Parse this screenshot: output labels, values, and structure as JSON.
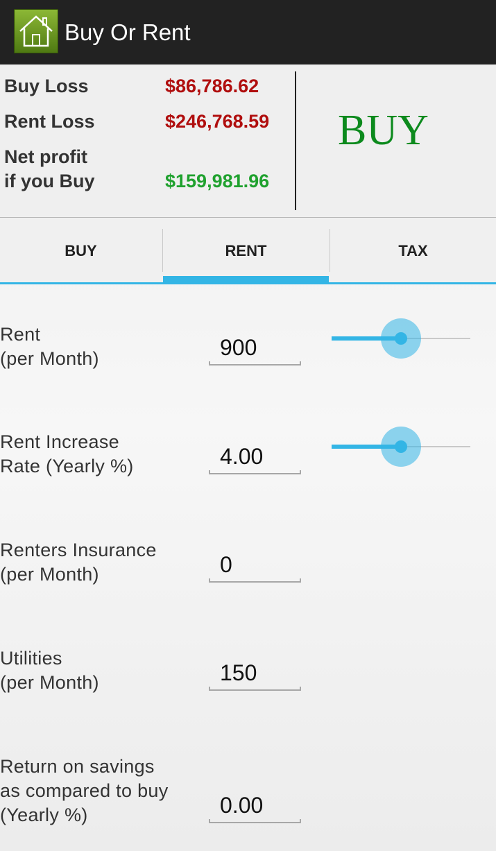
{
  "app": {
    "title": "Buy Or Rent",
    "icon": "house-icon"
  },
  "summary": {
    "buy_loss_label": "Buy Loss",
    "buy_loss_value": "$86,786.62",
    "rent_loss_label": "Rent Loss",
    "rent_loss_value": "$246,768.59",
    "net_profit_label_line1": "Net profit",
    "net_profit_label_line2": "if you Buy",
    "net_profit_value": "$159,981.96",
    "verdict": "BUY",
    "colors": {
      "loss": "#b00e0e",
      "profit": "#1fa12e",
      "verdict": "#0c8a1d"
    }
  },
  "tabs": [
    {
      "label": "BUY",
      "active": false
    },
    {
      "label": "RENT",
      "active": true
    },
    {
      "label": "TAX",
      "active": false
    }
  ],
  "accent_color": "#33b5e5",
  "rows": [
    {
      "label": "Rent\n(per Month)",
      "value": "900",
      "slider_percent": 50
    },
    {
      "label": "Rent Increase\nRate (Yearly %)",
      "value": "4.00",
      "slider_percent": 50
    },
    {
      "label": "Renters Insurance\n(per Month)",
      "value": "0"
    },
    {
      "label": "Utilities\n(per Month)",
      "value": "150"
    },
    {
      "label": "Return on savings\nas compared to buy\n(Yearly %)",
      "value": "0.00"
    }
  ]
}
